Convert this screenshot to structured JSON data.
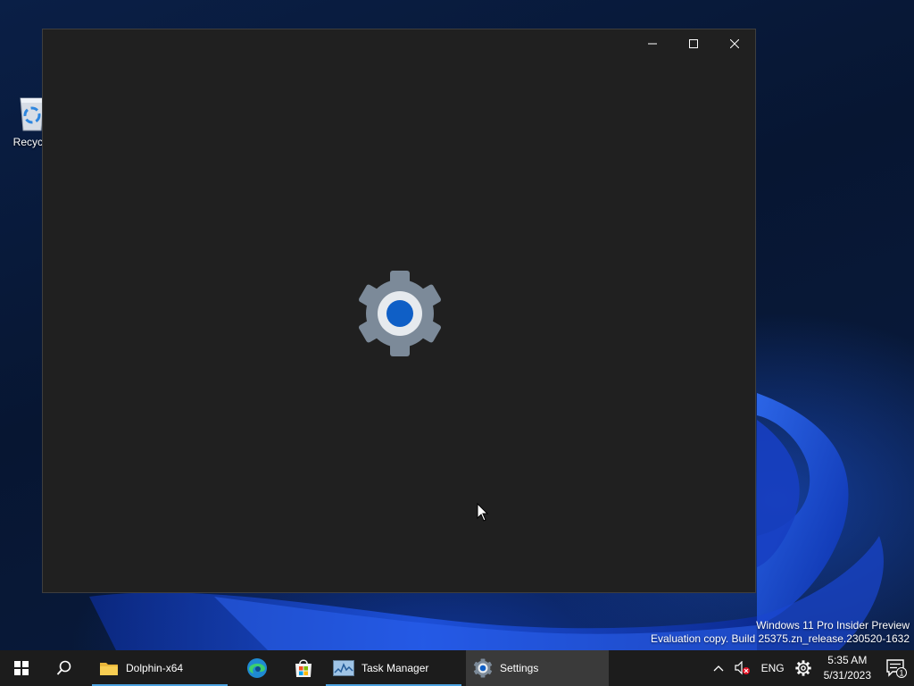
{
  "desktop": {
    "icons": [
      {
        "label": "Recycle",
        "icon": "recycle-bin-icon"
      }
    ],
    "watermark": {
      "line1": "Windows 11 Pro Insider Preview",
      "line2": "Evaluation copy. Build 25375.zn_release.230520-1632"
    }
  },
  "window": {
    "splash_icon": "settings-gear-icon",
    "controls": [
      "minimize-icon",
      "maximize-icon",
      "close-icon"
    ],
    "background": "#202020"
  },
  "taskbar": {
    "apps": [
      {
        "label": "Dolphin-x64",
        "icon": "folder-icon",
        "state": "open"
      },
      {
        "label": "",
        "icon": "edge-icon",
        "state": "pinned"
      },
      {
        "label": "",
        "icon": "store-icon",
        "state": "pinned"
      },
      {
        "label": "Task Manager",
        "icon": "task-manager-icon",
        "state": "open"
      },
      {
        "label": "Settings",
        "icon": "settings-icon",
        "state": "active"
      }
    ],
    "tray": {
      "language": "ENG",
      "time": "5:35 AM",
      "date": "5/31/2023",
      "notification_count": "1"
    }
  },
  "colors": {
    "accent": "#0f5fc6",
    "taskbar": "#1c1c1c",
    "window": "#202020"
  }
}
